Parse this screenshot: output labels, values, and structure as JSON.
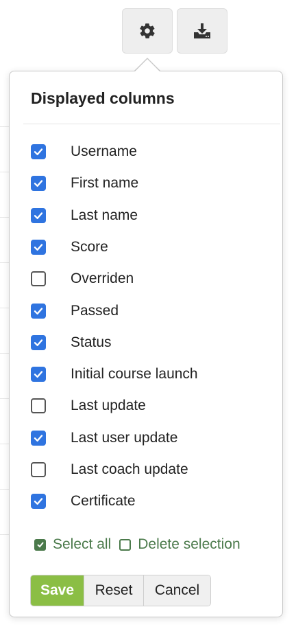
{
  "toolbar": {
    "settings_icon": "gear-icon",
    "download_icon": "download-icon"
  },
  "popover": {
    "title": "Displayed columns",
    "columns": [
      {
        "label": "Username",
        "checked": true
      },
      {
        "label": "First name",
        "checked": true
      },
      {
        "label": "Last name",
        "checked": true
      },
      {
        "label": "Score",
        "checked": true
      },
      {
        "label": "Overriden",
        "checked": false
      },
      {
        "label": "Passed",
        "checked": true
      },
      {
        "label": "Status",
        "checked": true
      },
      {
        "label": "Initial course launch",
        "checked": true
      },
      {
        "label": "Last update",
        "checked": false
      },
      {
        "label": "Last user update",
        "checked": true
      },
      {
        "label": "Last coach update",
        "checked": false
      },
      {
        "label": "Certificate",
        "checked": true
      }
    ],
    "select_all_label": "Select all",
    "delete_selection_label": "Delete selection",
    "save_label": "Save",
    "reset_label": "Reset",
    "cancel_label": "Cancel"
  },
  "colors": {
    "checkbox_checked": "#2f74e0",
    "link_green": "#4b7a4b",
    "save_green": "#8bbe45"
  }
}
